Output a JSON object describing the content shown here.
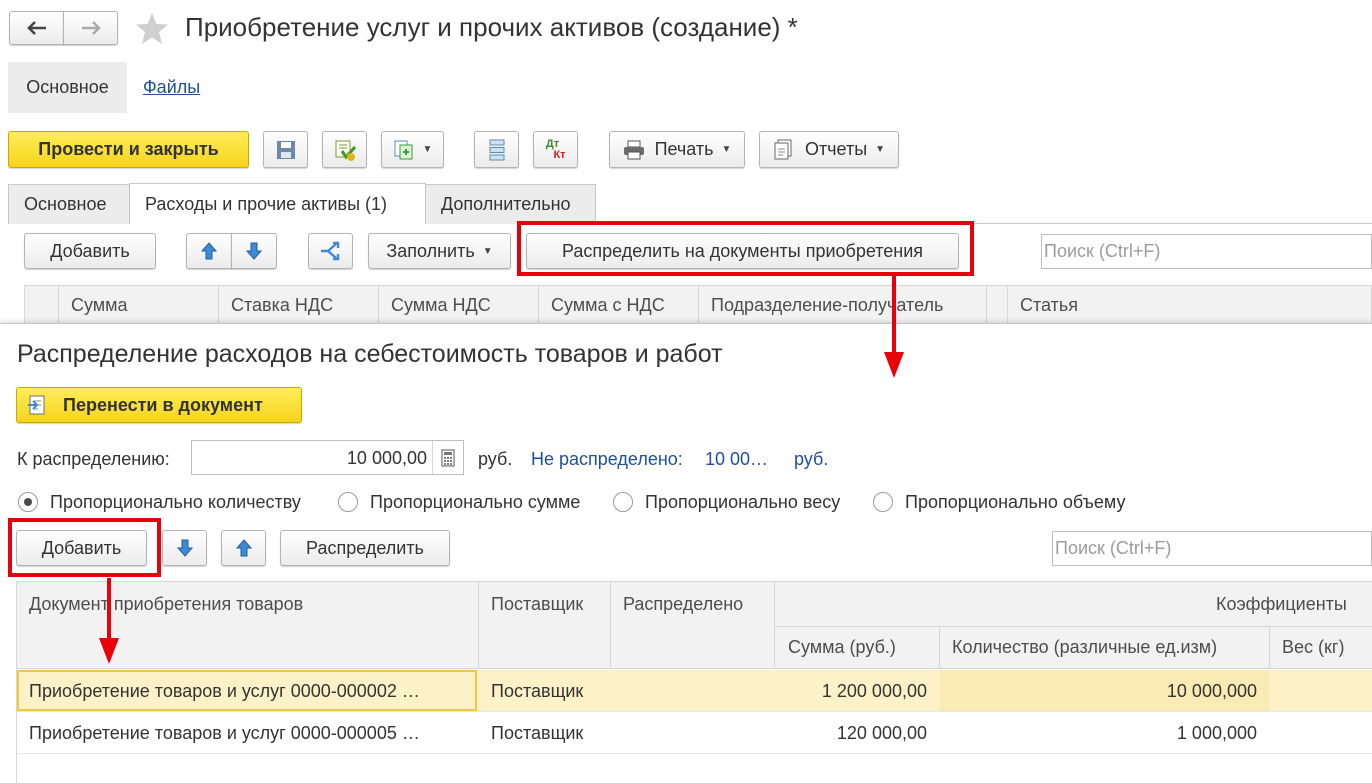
{
  "window": {
    "title": "Приобретение услуг и прочих активов (создание) *"
  },
  "nav_tabs": [
    {
      "label": "Основное"
    },
    {
      "label": "Файлы"
    }
  ],
  "toolbar": {
    "post_close": "Провести и закрыть",
    "print": "Печать",
    "reports": "Отчеты",
    "dtkt_top": "Дт",
    "dtkt_bottom": "Кт"
  },
  "doc_tabs": [
    {
      "label": "Основное"
    },
    {
      "label": "Расходы и прочие активы (1)"
    },
    {
      "label": "Дополнительно"
    }
  ],
  "expenses_toolbar": {
    "add": "Добавить",
    "fill": "Заполнить",
    "distribute_docs": "Распределить на документы приобретения",
    "search_placeholder": "Поиск (Ctrl+F)"
  },
  "expenses_table": {
    "columns": [
      "Сумма",
      "Ставка НДС",
      "Сумма НДС",
      "Сумма с НДС",
      "Подразделение-получатель",
      "Статья"
    ]
  },
  "dialog": {
    "title": "Распределение расходов на себестоимость товаров и работ",
    "transfer_button": "Перенести в документ",
    "to_distribute_label": "К распределению:",
    "to_distribute_value": "10 000,00",
    "currency": "руб.",
    "not_distributed_label": "Не распределено:",
    "not_distributed_value": "10 00…",
    "not_distributed_currency": "руб.",
    "radio_options": [
      {
        "label": "Пропорционально количеству",
        "selected": true
      },
      {
        "label": "Пропорционально сумме",
        "selected": false
      },
      {
        "label": "Пропорционально весу",
        "selected": false
      },
      {
        "label": "Пропорционально объему",
        "selected": false
      }
    ],
    "add": "Добавить",
    "distribute": "Распределить",
    "search_placeholder": "Поиск (Ctrl+F)"
  },
  "docs_table": {
    "col_document": "Документ приобретения товаров",
    "col_supplier": "Поставщик",
    "col_distributed": "Распределено",
    "col_coefficients": "Коэффициенты",
    "sub_sum": "Сумма (руб.)",
    "sub_qty": "Количество (различные ед.изм)",
    "sub_weight": "Вес (кг)",
    "rows": [
      {
        "document": "Приобретение товаров и услуг 0000-000002 …",
        "supplier": "Поставщик",
        "distributed": "",
        "sum": "1 200 000,00",
        "qty": "10 000,000",
        "weight": ""
      },
      {
        "document": "Приобретение товаров и услуг 0000-000005 …",
        "supplier": "Поставщик",
        "distributed": "",
        "sum": "120 000,00",
        "qty": "1 000,000",
        "weight": ""
      }
    ]
  },
  "colors": {
    "accent_yellow": "#f5d41a",
    "highlight_red": "#e8000b",
    "link_blue": "#1f4f9e",
    "selected_row": "#fdf2c7"
  }
}
